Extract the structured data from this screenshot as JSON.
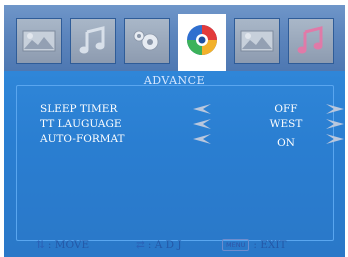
{
  "tabs": [
    {
      "name": "picture-tab",
      "icon": "picture-icon",
      "selected": false
    },
    {
      "name": "sound-tab",
      "icon": "music-notes-icon",
      "selected": false
    },
    {
      "name": "setup-tab",
      "icon": "gear-icon",
      "selected": false
    },
    {
      "name": "advance-tab",
      "icon": "swirl-icon",
      "selected": true
    },
    {
      "name": "picture-tab-2",
      "icon": "picture-icon",
      "selected": false
    },
    {
      "name": "sound-tab-2",
      "icon": "music-notes-icon",
      "selected": false
    }
  ],
  "panel": {
    "title": "ADVANCE",
    "items": [
      {
        "label": "SLEEP TIMER",
        "value": "OFF"
      },
      {
        "label": "TT LAUGUAGE",
        "value": "WEST"
      },
      {
        "label": "AUTO-FORMAT",
        "value": "ON"
      }
    ]
  },
  "footer": {
    "move_glyph": "⇅",
    "move_label": ": MOVE",
    "adj_glyph": "⇄",
    "adj_label": ": A D J",
    "menu_key": "MENU",
    "exit_label": ": EXIT"
  },
  "colors": {
    "tabbar": "#5c85bd",
    "panel": "#2a7ed1",
    "arrow": "#b9c7dd",
    "footer_text": "#2458a7"
  }
}
